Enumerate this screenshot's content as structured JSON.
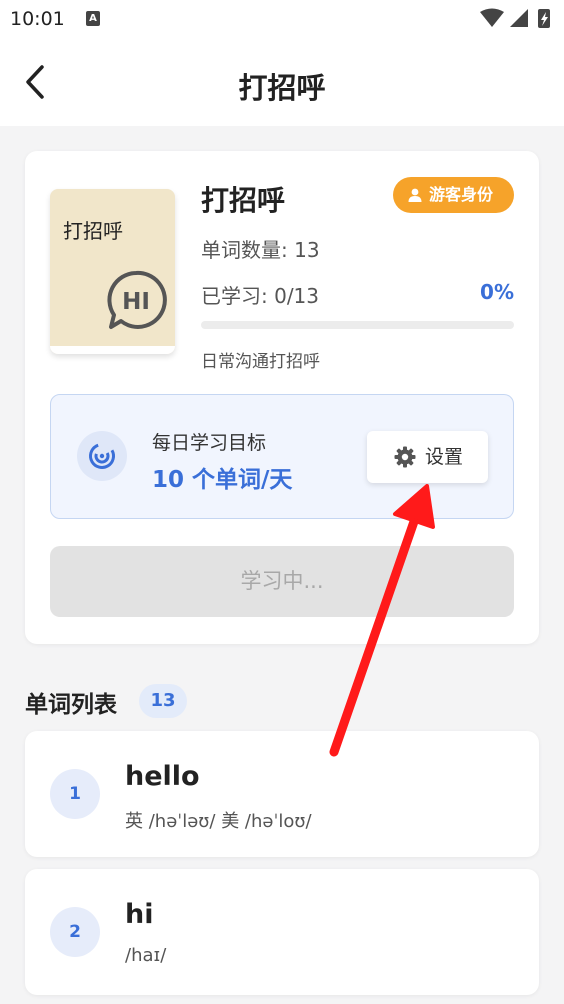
{
  "status_bar": {
    "time": "10:01",
    "notification_letter": "A"
  },
  "app_bar": {
    "title": "打招呼"
  },
  "book": {
    "cover_title": "打招呼",
    "cover_badge": "HI",
    "name": "打招呼",
    "guest_badge": "游客身份",
    "word_count": "单词数量: 13",
    "learned": "已学习: 0/13",
    "percent": "0%",
    "progress": 0,
    "description": "日常沟通打招呼"
  },
  "goal": {
    "label": "每日学习目标",
    "value": "10 个单词/天",
    "settings_button": "设置"
  },
  "study_button": "学习中...",
  "word_list": {
    "title": "单词列表",
    "count": "13",
    "items": [
      {
        "index": "1",
        "word": "hello",
        "phonetic": "英 /həˈləʊ/ 美 /həˈloʊ/"
      },
      {
        "index": "2",
        "word": "hi",
        "phonetic": "/haɪ/"
      }
    ]
  },
  "colors": {
    "accent": "#3a6fd8",
    "badge": "#f6a32a",
    "annotation_arrow": "#ff1a1a"
  }
}
